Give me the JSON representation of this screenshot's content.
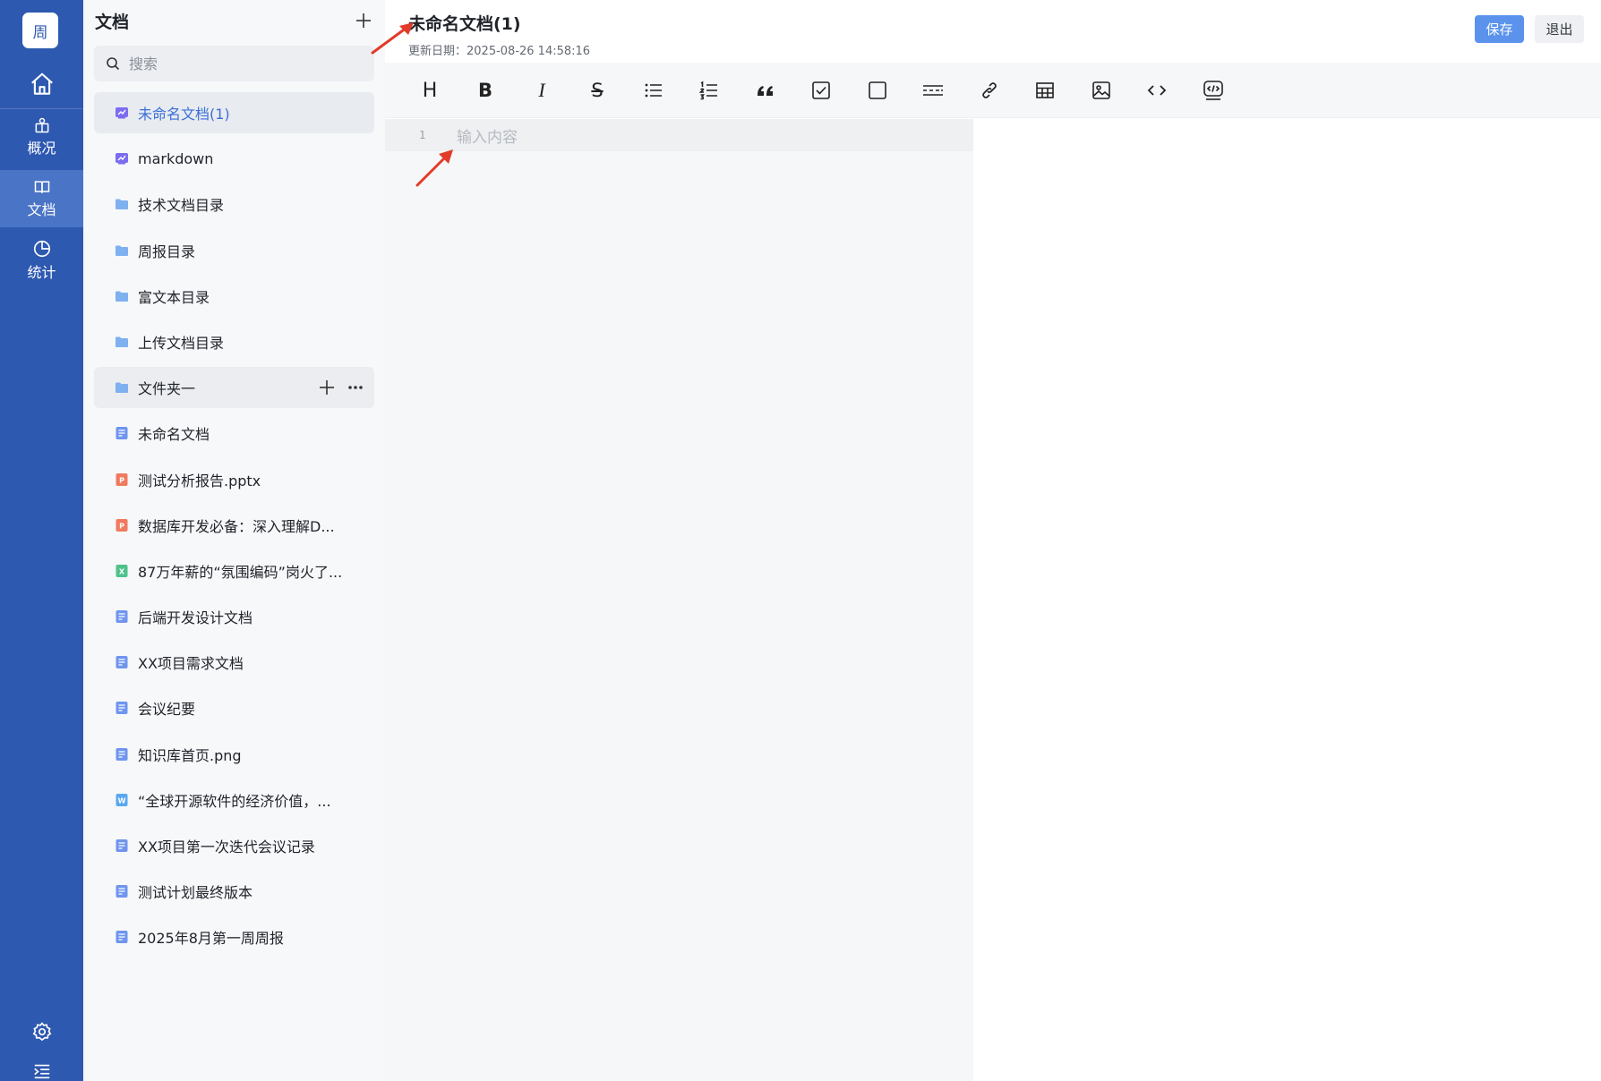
{
  "rail": {
    "avatar": "周",
    "items": [
      {
        "label": "概况"
      },
      {
        "label": "文档"
      },
      {
        "label": "统计"
      }
    ]
  },
  "panel": {
    "title": "文档",
    "search_placeholder": "搜索",
    "items": [
      {
        "label": "未命名文档(1)",
        "icon": "mindmap-doc-icon"
      },
      {
        "label": "markdown",
        "icon": "mindmap-doc-icon"
      },
      {
        "label": "技术文档目录",
        "icon": "folder-icon"
      },
      {
        "label": "周报目录",
        "icon": "folder-icon"
      },
      {
        "label": "富文本目录",
        "icon": "folder-icon"
      },
      {
        "label": "上传文档目录",
        "icon": "folder-icon"
      },
      {
        "label": "文件夹一",
        "icon": "folder-icon"
      },
      {
        "label": "未命名文档",
        "icon": "text-doc-icon"
      },
      {
        "label": "测试分析报告.pptx",
        "icon": "ppt-file-icon"
      },
      {
        "label": "数据库开发必备：深入理解D...",
        "icon": "ppt-file-icon"
      },
      {
        "label": "87万年薪的“氛围编码”岗火了...",
        "icon": "excel-file-icon"
      },
      {
        "label": "后端开发设计文档",
        "icon": "text-doc-icon"
      },
      {
        "label": "XX项目需求文档",
        "icon": "text-doc-icon"
      },
      {
        "label": "会议纪要",
        "icon": "text-doc-icon"
      },
      {
        "label": "知识库首页.png",
        "icon": "text-doc-icon"
      },
      {
        "label": "“全球开源软件的经济价值，...",
        "icon": "word-file-icon"
      },
      {
        "label": "XX项目第一次迭代会议记录",
        "icon": "text-doc-icon"
      },
      {
        "label": "测试计划最终版本",
        "icon": "text-doc-icon"
      },
      {
        "label": "2025年8月第一周周报",
        "icon": "text-doc-icon"
      }
    ]
  },
  "doc": {
    "title": "未命名文档(1)",
    "updated": "更新日期：2025-08-26 14:58:16",
    "save_label": "保存",
    "exit_label": "退出"
  },
  "editor": {
    "line_number": "1",
    "placeholder": "输入内容"
  },
  "toolbar": {
    "heading_glyph": "H",
    "bold_glyph": "B",
    "italic_glyph": "I",
    "strike_glyph": "S"
  },
  "colors": {
    "rail": "#2e59b0",
    "accent": "#3a6fd8",
    "save_button": "#5b93ec",
    "annotation_arrow": "#e23b2a"
  }
}
